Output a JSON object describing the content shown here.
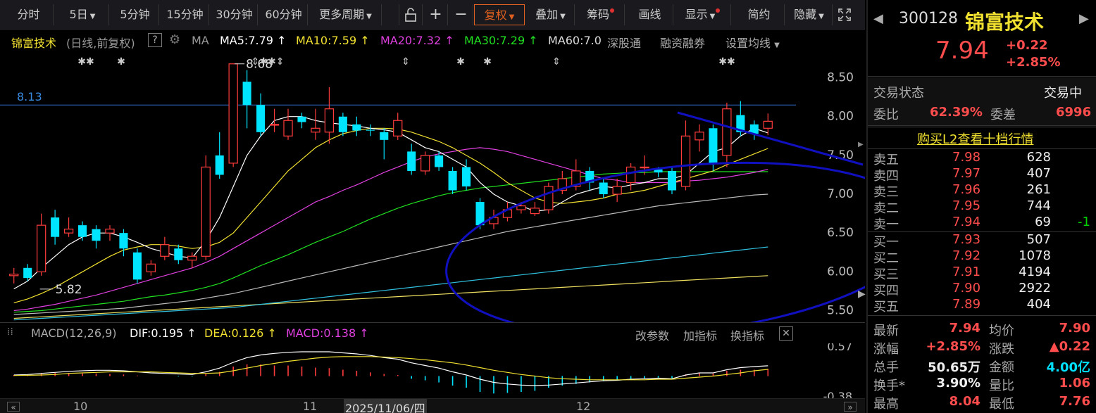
{
  "toolbar": {
    "periods": [
      "分时",
      "5日",
      "5分钟",
      "15分钟",
      "30分钟",
      "60分钟",
      "更多周期"
    ],
    "zoom_in": "+",
    "zoom_out": "−",
    "fuquan": "复权",
    "overlay": "叠加",
    "chips": "筹码",
    "draw": "画线",
    "display": "显示",
    "simple": "简约",
    "hide": "隐藏"
  },
  "info": {
    "stock_name": "锦富技术",
    "mode": "(日线,前复权)",
    "help": "?",
    "ma_label": "MA",
    "ma5": "MA5:7.79",
    "ma10": "MA10:7.59",
    "ma20": "MA20:7.32",
    "ma30": "MA30:7.29",
    "ma60": "MA60:7.0",
    "sgt": "深股通",
    "rzrq": "融资融券",
    "set_ma": "设置均线"
  },
  "chart_data": {
    "type": "candlestick",
    "y_ticks": [
      "8.50",
      "8.00",
      "7.50",
      "7.00",
      "6.50",
      "6.00",
      "5.50"
    ],
    "ylim": [
      5.35,
      8.85
    ],
    "ref_line": {
      "value": 8.15,
      "label": "8.13"
    },
    "high_label": "8.68",
    "low_label": "5.82",
    "x_labels": [
      "10",
      "11",
      "2025/11/06/四",
      "12"
    ],
    "candles": [
      {
        "o": 5.95,
        "c": 5.97,
        "h": 6.05,
        "l": 5.85
      },
      {
        "o": 6.05,
        "c": 5.92,
        "h": 6.1,
        "l": 5.88
      },
      {
        "o": 6.0,
        "c": 6.6,
        "h": 6.75,
        "l": 5.95
      },
      {
        "o": 6.7,
        "c": 6.45,
        "h": 6.8,
        "l": 6.35
      },
      {
        "o": 6.5,
        "c": 6.55,
        "h": 6.7,
        "l": 6.45
      },
      {
        "o": 6.6,
        "c": 6.45,
        "h": 6.65,
        "l": 6.4
      },
      {
        "o": 6.55,
        "c": 6.4,
        "h": 6.6,
        "l": 6.3
      },
      {
        "o": 6.5,
        "c": 6.55,
        "h": 6.6,
        "l": 6.4
      },
      {
        "o": 6.5,
        "c": 6.3,
        "h": 6.55,
        "l": 6.2
      },
      {
        "o": 6.25,
        "c": 5.9,
        "h": 6.3,
        "l": 5.85
      },
      {
        "o": 6.0,
        "c": 6.1,
        "h": 6.15,
        "l": 5.95
      },
      {
        "o": 6.2,
        "c": 6.35,
        "h": 6.45,
        "l": 6.15
      },
      {
        "o": 6.3,
        "c": 6.15,
        "h": 6.35,
        "l": 6.1
      },
      {
        "o": 6.15,
        "c": 6.2,
        "h": 6.25,
        "l": 6.05
      },
      {
        "o": 6.2,
        "c": 7.35,
        "h": 7.5,
        "l": 6.15
      },
      {
        "o": 7.5,
        "c": 7.25,
        "h": 7.8,
        "l": 7.2
      },
      {
        "o": 7.4,
        "c": 8.68,
        "h": 8.68,
        "l": 7.35
      },
      {
        "o": 8.45,
        "c": 8.15,
        "h": 8.6,
        "l": 7.85
      },
      {
        "o": 8.15,
        "c": 7.8,
        "h": 8.3,
        "l": 7.75
      },
      {
        "o": 7.9,
        "c": 7.9,
        "h": 8.1,
        "l": 7.8
      },
      {
        "o": 7.75,
        "c": 7.95,
        "h": 8.1,
        "l": 7.7
      },
      {
        "o": 8.0,
        "c": 7.93,
        "h": 8.05,
        "l": 7.85
      },
      {
        "o": 7.8,
        "c": 7.85,
        "h": 8.1,
        "l": 7.7
      },
      {
        "o": 7.8,
        "c": 8.1,
        "h": 8.38,
        "l": 7.65
      },
      {
        "o": 8.0,
        "c": 7.8,
        "h": 8.05,
        "l": 7.75
      },
      {
        "o": 7.9,
        "c": 7.82,
        "h": 8.0,
        "l": 7.75
      },
      {
        "o": 7.83,
        "c": 7.82,
        "h": 7.9,
        "l": 7.75
      },
      {
        "o": 7.8,
        "c": 7.7,
        "h": 7.85,
        "l": 7.45
      },
      {
        "o": 7.75,
        "c": 7.95,
        "h": 8.05,
        "l": 7.7
      },
      {
        "o": 7.55,
        "c": 7.3,
        "h": 7.65,
        "l": 7.25
      },
      {
        "o": 7.3,
        "c": 7.5,
        "h": 7.55,
        "l": 7.25
      },
      {
        "o": 7.5,
        "c": 7.35,
        "h": 7.55,
        "l": 7.3
      },
      {
        "o": 7.3,
        "c": 7.05,
        "h": 7.35,
        "l": 7.0
      },
      {
        "o": 7.35,
        "c": 7.1,
        "h": 7.45,
        "l": 7.05
      },
      {
        "o": 6.9,
        "c": 6.6,
        "h": 6.95,
        "l": 6.55
      },
      {
        "o": 6.62,
        "c": 6.7,
        "h": 6.8,
        "l": 6.55
      },
      {
        "o": 6.7,
        "c": 6.8,
        "h": 6.9,
        "l": 6.65
      },
      {
        "o": 6.8,
        "c": 6.85,
        "h": 6.9,
        "l": 6.75
      },
      {
        "o": 6.75,
        "c": 6.82,
        "h": 6.9,
        "l": 6.72
      },
      {
        "o": 6.8,
        "c": 7.1,
        "h": 7.15,
        "l": 6.75
      },
      {
        "o": 7.05,
        "c": 7.2,
        "h": 7.3,
        "l": 7.0
      },
      {
        "o": 7.1,
        "c": 7.3,
        "h": 7.45,
        "l": 7.05
      },
      {
        "o": 7.3,
        "c": 7.15,
        "h": 7.35,
        "l": 7.05
      },
      {
        "o": 7.15,
        "c": 7.0,
        "h": 7.2,
        "l": 6.95
      },
      {
        "o": 7.0,
        "c": 7.1,
        "h": 7.2,
        "l": 6.9
      },
      {
        "o": 7.15,
        "c": 7.35,
        "h": 7.4,
        "l": 7.05
      },
      {
        "o": 7.35,
        "c": 7.35,
        "h": 7.5,
        "l": 7.25
      },
      {
        "o": 7.32,
        "c": 7.28,
        "h": 7.35,
        "l": 7.22
      },
      {
        "o": 7.3,
        "c": 7.05,
        "h": 7.35,
        "l": 7.0
      },
      {
        "o": 7.1,
        "c": 7.75,
        "h": 7.95,
        "l": 7.05
      },
      {
        "o": 7.7,
        "c": 7.8,
        "h": 7.9,
        "l": 7.55
      },
      {
        "o": 7.85,
        "c": 7.4,
        "h": 7.9,
        "l": 7.3
      },
      {
        "o": 7.5,
        "c": 8.1,
        "h": 8.18,
        "l": 7.35
      },
      {
        "o": 8.02,
        "c": 7.8,
        "h": 8.2,
        "l": 7.75
      },
      {
        "o": 7.9,
        "c": 7.78,
        "h": 7.95,
        "l": 7.7
      },
      {
        "o": 7.85,
        "c": 7.94,
        "h": 8.04,
        "l": 7.76
      }
    ],
    "ma_lines": {
      "ma5": [
        5.78,
        5.88,
        6.05,
        6.2,
        6.35,
        6.45,
        6.5,
        6.5,
        6.45,
        6.38,
        6.3,
        6.25,
        6.2,
        6.18,
        6.4,
        6.7,
        7.1,
        7.5,
        7.75,
        7.95,
        8.0,
        8.0,
        7.95,
        7.92,
        7.9,
        7.88,
        7.85,
        7.83,
        7.8,
        7.7,
        7.6,
        7.55,
        7.45,
        7.35,
        7.15,
        7.0,
        6.9,
        6.85,
        6.78,
        6.8,
        6.9,
        7.0,
        7.05,
        7.1,
        7.08,
        7.12,
        7.15,
        7.2,
        7.2,
        7.25,
        7.4,
        7.55,
        7.6,
        7.75,
        7.85,
        7.79
      ],
      "ma10": [
        5.6,
        5.65,
        5.72,
        5.8,
        5.9,
        6.0,
        6.1,
        6.2,
        6.28,
        6.32,
        6.35,
        6.35,
        6.33,
        6.3,
        6.32,
        6.38,
        6.5,
        6.7,
        6.9,
        7.1,
        7.3,
        7.45,
        7.6,
        7.7,
        7.78,
        7.82,
        7.85,
        7.85,
        7.84,
        7.8,
        7.74,
        7.68,
        7.6,
        7.5,
        7.4,
        7.28,
        7.15,
        7.05,
        6.95,
        6.9,
        6.88,
        6.9,
        6.92,
        6.95,
        7.0,
        7.02,
        7.05,
        7.1,
        7.15,
        7.2,
        7.25,
        7.3,
        7.38,
        7.45,
        7.52,
        7.59
      ],
      "ma20": [
        5.5,
        5.52,
        5.55,
        5.58,
        5.62,
        5.66,
        5.7,
        5.75,
        5.8,
        5.85,
        5.9,
        5.95,
        6.0,
        6.05,
        6.12,
        6.2,
        6.3,
        6.4,
        6.5,
        6.6,
        6.7,
        6.8,
        6.9,
        6.97,
        7.05,
        7.12,
        7.2,
        7.28,
        7.35,
        7.42,
        7.48,
        7.52,
        7.55,
        7.58,
        7.6,
        7.58,
        7.55,
        7.5,
        7.45,
        7.4,
        7.35,
        7.3,
        7.25,
        7.2,
        7.18,
        7.15,
        7.15,
        7.15,
        7.15,
        7.17,
        7.18,
        7.2,
        7.22,
        7.25,
        7.28,
        7.32
      ],
      "ma30": [
        5.48,
        5.49,
        5.5,
        5.52,
        5.54,
        5.56,
        5.58,
        5.6,
        5.62,
        5.65,
        5.68,
        5.7,
        5.73,
        5.76,
        5.8,
        5.85,
        5.92,
        6.0,
        6.08,
        6.15,
        6.22,
        6.3,
        6.38,
        6.45,
        6.52,
        6.6,
        6.68,
        6.75,
        6.82,
        6.88,
        6.93,
        6.98,
        7.02,
        7.05,
        7.08,
        7.1,
        7.12,
        7.14,
        7.16,
        7.18,
        7.2,
        7.22,
        7.24,
        7.26,
        7.27,
        7.28,
        7.28,
        7.29,
        7.29,
        7.29,
        7.29,
        7.29,
        7.29,
        7.29,
        7.29,
        7.29
      ],
      "ma60": [
        5.45,
        5.46,
        5.47,
        5.48,
        5.49,
        5.5,
        5.51,
        5.52,
        5.53,
        5.55,
        5.57,
        5.59,
        5.61,
        5.63,
        5.66,
        5.69,
        5.72,
        5.76,
        5.8,
        5.84,
        5.88,
        5.92,
        5.96,
        6.0,
        6.04,
        6.08,
        6.12,
        6.16,
        6.2,
        6.24,
        6.28,
        6.32,
        6.36,
        6.4,
        6.44,
        6.48,
        6.52,
        6.55,
        6.58,
        6.61,
        6.64,
        6.67,
        6.7,
        6.73,
        6.76,
        6.79,
        6.82,
        6.85,
        6.87,
        6.89,
        6.91,
        6.93,
        6.95,
        6.97,
        6.99,
        7.0
      ],
      "ma120": [
        5.38,
        5.39,
        5.4,
        5.41,
        5.42,
        5.43,
        5.44,
        5.45,
        5.46,
        5.47,
        5.48,
        5.49,
        5.5,
        5.51,
        5.52,
        5.53,
        5.54,
        5.56,
        5.58,
        5.6,
        5.62,
        5.64,
        5.66,
        5.68,
        5.7,
        5.72,
        5.74,
        5.76,
        5.78,
        5.8,
        5.82,
        5.84,
        5.86,
        5.88,
        5.9,
        5.92,
        5.94,
        5.96,
        5.98,
        6.0,
        6.02,
        6.04,
        6.06,
        6.08,
        6.1,
        6.12,
        6.14,
        6.16,
        6.18,
        6.2,
        6.22,
        6.24,
        6.26,
        6.28,
        6.3,
        6.32
      ],
      "ma250": [
        5.4,
        5.41,
        5.42,
        5.43,
        5.44,
        5.45,
        5.46,
        5.47,
        5.48,
        5.49,
        5.5,
        5.51,
        5.52,
        5.53,
        5.54,
        5.55,
        5.56,
        5.57,
        5.58,
        5.59,
        5.6,
        5.61,
        5.62,
        5.63,
        5.64,
        5.65,
        5.66,
        5.67,
        5.68,
        5.69,
        5.7,
        5.71,
        5.72,
        5.73,
        5.74,
        5.75,
        5.76,
        5.77,
        5.78,
        5.79,
        5.8,
        5.81,
        5.82,
        5.83,
        5.84,
        5.85,
        5.86,
        5.87,
        5.88,
        5.89,
        5.9,
        5.91,
        5.92,
        5.93,
        5.94,
        5.95
      ]
    },
    "macd": {
      "label": "MACD(12,26,9)",
      "dif": "DIF:0.195",
      "dea": "DEA:0.126",
      "macd": "MACD:0.138",
      "y_ticks": [
        "0.57",
        "-0.38"
      ],
      "ylim": [
        -0.42,
        0.62
      ],
      "hist": [
        0.02,
        0.03,
        0.05,
        0.06,
        0.06,
        0.05,
        0.05,
        0.04,
        0.03,
        0.01,
        0.0,
        0.0,
        -0.01,
        -0.01,
        0.04,
        0.08,
        0.18,
        0.22,
        0.22,
        0.2,
        0.2,
        0.18,
        0.16,
        0.15,
        0.12,
        0.1,
        0.07,
        0.04,
        0.02,
        -0.05,
        -0.08,
        -0.12,
        -0.18,
        -0.22,
        -0.3,
        -0.33,
        -0.32,
        -0.3,
        -0.28,
        -0.22,
        -0.18,
        -0.15,
        -0.12,
        -0.1,
        -0.08,
        -0.05,
        -0.04,
        -0.03,
        -0.04,
        0.03,
        0.06,
        0.05,
        0.1,
        0.12,
        0.12,
        0.138
      ],
      "dif_line": [
        0.02,
        0.03,
        0.05,
        0.07,
        0.09,
        0.1,
        0.11,
        0.11,
        0.1,
        0.08,
        0.06,
        0.05,
        0.04,
        0.03,
        0.08,
        0.15,
        0.26,
        0.35,
        0.4,
        0.43,
        0.45,
        0.46,
        0.46,
        0.46,
        0.44,
        0.42,
        0.39,
        0.35,
        0.32,
        0.25,
        0.2,
        0.15,
        0.08,
        0.02,
        -0.06,
        -0.12,
        -0.15,
        -0.17,
        -0.18,
        -0.17,
        -0.15,
        -0.13,
        -0.11,
        -0.09,
        -0.08,
        -0.06,
        -0.05,
        -0.04,
        -0.05,
        0.02,
        0.06,
        0.06,
        0.12,
        0.16,
        0.18,
        0.195
      ],
      "dea_line": [
        0.01,
        0.015,
        0.02,
        0.03,
        0.05,
        0.06,
        0.07,
        0.08,
        0.08,
        0.08,
        0.08,
        0.07,
        0.06,
        0.05,
        0.05,
        0.06,
        0.1,
        0.15,
        0.2,
        0.24,
        0.28,
        0.31,
        0.34,
        0.36,
        0.37,
        0.37,
        0.37,
        0.36,
        0.35,
        0.33,
        0.31,
        0.28,
        0.25,
        0.21,
        0.16,
        0.11,
        0.07,
        0.03,
        0.0,
        -0.03,
        -0.05,
        -0.06,
        -0.07,
        -0.07,
        -0.07,
        -0.07,
        -0.07,
        -0.06,
        -0.06,
        -0.04,
        -0.02,
        0.0,
        0.03,
        0.06,
        0.1,
        0.126
      ]
    }
  },
  "macd_actions": [
    "改参数",
    "加指标",
    "换指标"
  ],
  "markers": [
    "✱✱",
    "✱",
    "⇕✱✱⇕",
    "⇕",
    "✱",
    "✱",
    "⇕",
    "✱✱"
  ],
  "right": {
    "code": "300128",
    "name": "锦富技术",
    "price": "7.94",
    "change": "+0.22",
    "change_pct": "+2.85%",
    "status_label": "交易状态",
    "status_value": "交易中",
    "weibi_label": "委比",
    "weibi_value": "62.39%",
    "weicha_label": "委差",
    "weicha_value": "6996",
    "l2_link": "购买L2查看十档行情",
    "asks": [
      {
        "label": "卖五",
        "price": "7.98",
        "vol": "628",
        "chg": ""
      },
      {
        "label": "卖四",
        "price": "7.97",
        "vol": "407",
        "chg": ""
      },
      {
        "label": "卖三",
        "price": "7.96",
        "vol": "261",
        "chg": ""
      },
      {
        "label": "卖二",
        "price": "7.95",
        "vol": "744",
        "chg": ""
      },
      {
        "label": "卖一",
        "price": "7.94",
        "vol": "69",
        "chg": "-1"
      }
    ],
    "bids": [
      {
        "label": "买一",
        "price": "7.93",
        "vol": "507"
      },
      {
        "label": "买二",
        "price": "7.92",
        "vol": "1078"
      },
      {
        "label": "买三",
        "price": "7.91",
        "vol": "4194"
      },
      {
        "label": "买四",
        "price": "7.90",
        "vol": "2922"
      },
      {
        "label": "买五",
        "price": "7.89",
        "vol": "404"
      }
    ],
    "stats": [
      {
        "l1": "最新",
        "v1": "7.94",
        "c1": "red",
        "l2": "均价",
        "v2": "7.90",
        "c2": "red"
      },
      {
        "l1": "涨幅",
        "v1": "+2.85%",
        "c1": "red",
        "l2": "涨跌",
        "v2": "▲0.22",
        "c2": "red"
      },
      {
        "l1": "总手",
        "v1": "50.65万",
        "c1": "white",
        "l2": "金额",
        "v2": "4.00亿",
        "c2": "cyan"
      },
      {
        "l1": "换手*",
        "v1": "3.90%",
        "c1": "white",
        "l2": "量比",
        "v2": "1.06",
        "c2": "red"
      },
      {
        "l1": "最高",
        "v1": "8.04",
        "c1": "red",
        "l2": "最低",
        "v2": "7.76",
        "c2": "red"
      }
    ]
  },
  "colors": {
    "up": "#ff3c3c",
    "down": "#00e5ff",
    "ma5": "#ffffff",
    "ma10": "#f0e030",
    "ma20": "#e040e0",
    "ma30": "#20e020",
    "ma60": "#bbbbbb",
    "ma120": "#30c0e0",
    "ma250": "#f0e060",
    "ref": "#3070d0",
    "annot": "#1010c0"
  }
}
